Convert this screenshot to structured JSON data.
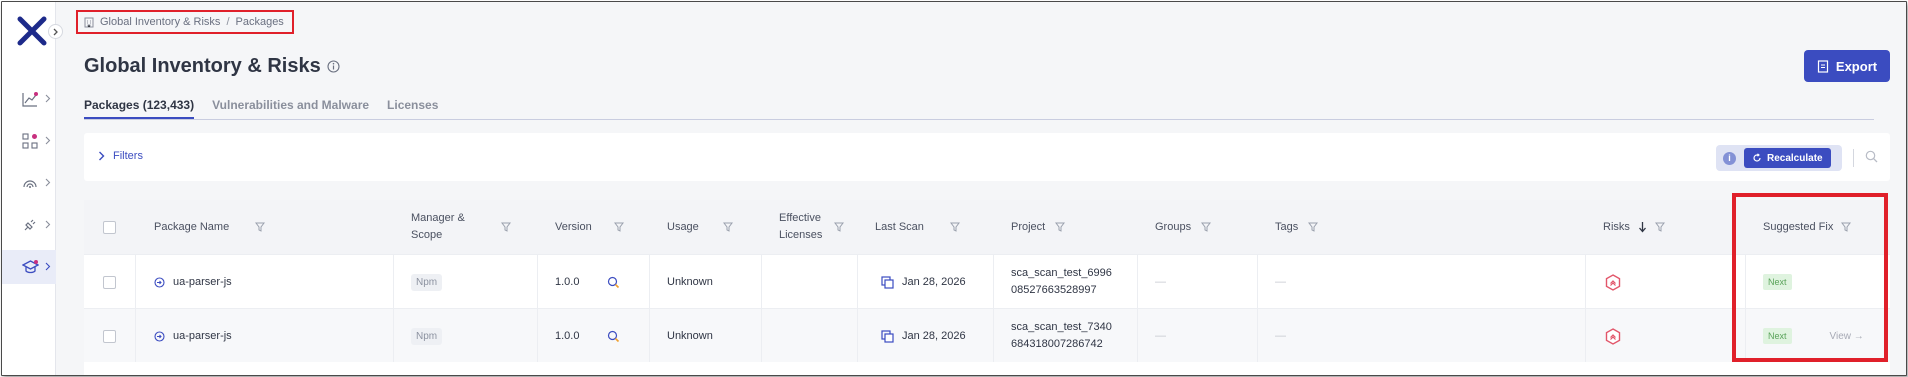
{
  "breadcrumb": {
    "items": [
      "Global Inventory & Risks",
      "Packages"
    ],
    "separator": "/"
  },
  "page": {
    "title": "Global Inventory & Risks"
  },
  "export_label": "Export",
  "tabs": [
    {
      "label": "Packages (123,433)",
      "active": true
    },
    {
      "label": "Vulnerabilities and Malware",
      "active": false
    },
    {
      "label": "Licenses",
      "active": false
    }
  ],
  "filters": {
    "label": "Filters",
    "recalc_label": "Recalculate"
  },
  "table": {
    "headers": {
      "package_name": "Package Name",
      "manager_scope_1": "Manager &",
      "manager_scope_2": "Scope",
      "version": "Version",
      "usage": "Usage",
      "licenses_1": "Effective",
      "licenses_2": "Licenses",
      "last_scan": "Last Scan",
      "project": "Project",
      "groups": "Groups",
      "tags": "Tags",
      "risks": "Risks",
      "suggested_fix": "Suggested Fix"
    },
    "rows": [
      {
        "package": "ua-parser-js",
        "manager": "Npm",
        "version": "1.0.0",
        "usage": "Unknown",
        "last_scan": "Jan 28, 2026",
        "project_1": "sca_scan_test_6996",
        "project_2": "08527663528997",
        "groups": "—",
        "tags": "—",
        "fix": "Next",
        "fix_link": ""
      },
      {
        "package": "ua-parser-js",
        "manager": "Npm",
        "version": "1.0.0",
        "usage": "Unknown",
        "last_scan": "Jan 28, 2026",
        "project_1": "sca_scan_test_7340",
        "project_2": "684318007286742",
        "groups": "—",
        "tags": "—",
        "fix": "Next",
        "fix_link": "View →"
      }
    ]
  },
  "colors": {
    "accent": "#3b4cc0",
    "highlight": "#e0202a",
    "risk": "#e2566a",
    "next_badge": "#dff3df"
  },
  "icons": [
    "logo-x-icon",
    "chevron-right-icon",
    "trend-icon",
    "apps-icon",
    "radar-icon",
    "plug-icon",
    "graduation-cap-icon",
    "building-icon",
    "info-icon",
    "export-icon",
    "refresh-icon",
    "search-icon",
    "filter-icon",
    "sort-down-icon",
    "package-icon",
    "copy-icon",
    "risk-hexagon-icon"
  ]
}
